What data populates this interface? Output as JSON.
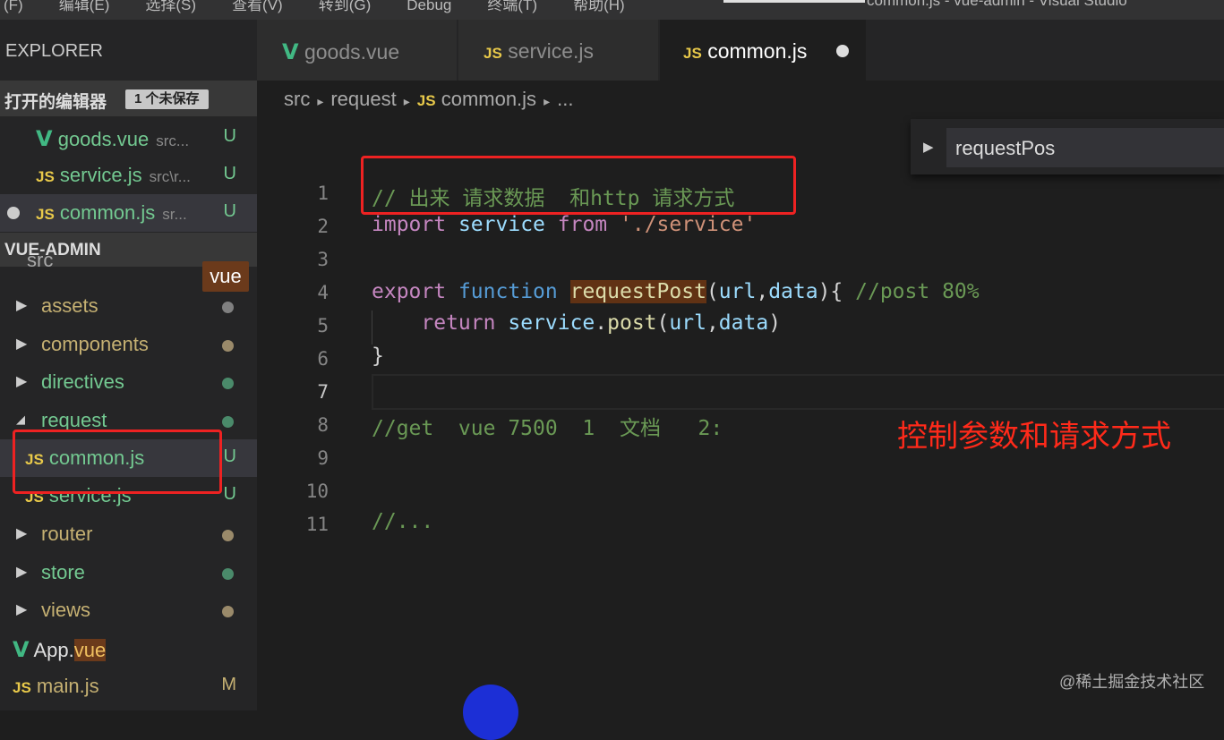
{
  "menubar": {
    "items": [
      "(F)",
      "编辑(E)",
      "选择(S)",
      "查看(V)",
      "转到(G)",
      "Debug",
      "终端(T)",
      "帮助(H)"
    ],
    "window_title": "common.js - vue-admin - Visual Studio"
  },
  "sidebar": {
    "header": "EXPLORER",
    "open_editors": {
      "title": "打开的编辑器",
      "badge": "1 个未保存",
      "items": [
        {
          "name": "goods.vue",
          "path": "src...",
          "status": "U",
          "icon": "vue-icon"
        },
        {
          "name": "service.js",
          "path": "src\\r...",
          "status": "U",
          "icon": "js-icon"
        },
        {
          "name": "common.js",
          "path": "sr...",
          "status": "U",
          "icon": "js-icon"
        }
      ]
    },
    "project": {
      "title": "VUE-ADMIN",
      "src_label": "src",
      "hover_tip": "vue",
      "folders": [
        {
          "name": "assets",
          "dot_color": "#808080"
        },
        {
          "name": "components",
          "dot_color": "#9a8a6a"
        },
        {
          "name": "directives",
          "dot_color": "#4a8a6a"
        },
        {
          "name": "request",
          "dot_color": "#4a8a6a"
        }
      ],
      "request_files": [
        {
          "name": "common.js",
          "status": "U"
        },
        {
          "name": "service.js",
          "status": "U"
        }
      ],
      "folders2": [
        {
          "name": "router",
          "dot_color": "#9a8a6a"
        },
        {
          "name": "store",
          "dot_color": "#4a8a6a"
        },
        {
          "name": "views",
          "dot_color": "#9a8a6a"
        }
      ],
      "app_file": {
        "name_a": "App.",
        "name_b": "vue"
      },
      "main_file": {
        "name": "main.js",
        "status": "M"
      }
    }
  },
  "tabs": [
    {
      "label": "goods.vue",
      "icon": "vue-icon"
    },
    {
      "label": "service.js",
      "icon": "js-icon"
    },
    {
      "label": "common.js",
      "icon": "js-icon",
      "modified": true
    }
  ],
  "breadcrumb": {
    "parts": [
      "src",
      "request",
      "common.js",
      "..."
    ]
  },
  "outline": {
    "item": "requestPos"
  },
  "editor": {
    "line_numbers": [
      "1",
      "2",
      "3",
      "4",
      "5",
      "6",
      "7",
      "8",
      "9",
      "10",
      "11"
    ],
    "lines": {
      "l1": "// 出来 请求数据  和http 请求方式",
      "l2_import": "import",
      "l2_service": "service",
      "l2_from": "from",
      "l2_path": "'./service'",
      "l4_export": "export",
      "l4_function": "function",
      "l4_name": "requestPost",
      "l4_open": "(",
      "l4_url": "url",
      "l4_comma": ",",
      "l4_data": "data",
      "l4_close": "){",
      "l4_comment": "//post 80%",
      "l5_return": "return",
      "l5_service": "service",
      "l5_dot": ".",
      "l5_post": "post",
      "l5_open": "(",
      "l5_url": "url",
      "l5_comma": ",",
      "l5_data": "data",
      "l5_close": ")",
      "l6": "}",
      "l8": "//get  vue 7500  1  文档   2:",
      "l11": "//..."
    }
  },
  "annotation": {
    "note": "控制参数和请求方式"
  },
  "watermark": "@稀土掘金技术社区",
  "colors": {
    "accent_red": "#ee2222",
    "js_yellow": "#e8c94a",
    "vue_green": "#41b883"
  }
}
